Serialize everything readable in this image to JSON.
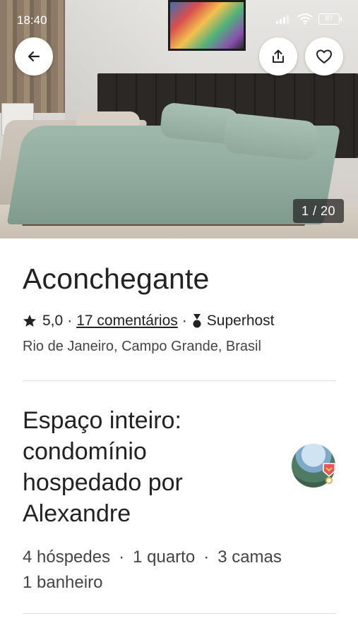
{
  "status_bar": {
    "time": "18:40",
    "battery": "87"
  },
  "gallery": {
    "counter": "1 / 20"
  },
  "listing": {
    "title": "Aconchegante",
    "rating": "5,0",
    "reviews": "17 comentários",
    "superhost_label": "Superhost",
    "location": "Rio de Janeiro, Campo Grande, Brasil"
  },
  "host_section": {
    "title_lines": [
      "Espaço inteiro:",
      "condomínio",
      "hospedado por",
      "Alexandre"
    ]
  },
  "specs": {
    "guests": "4 hóspedes",
    "bedrooms": "1 quarto",
    "beds": "3 camas",
    "bathrooms": "1 banheiro"
  },
  "icons": {
    "back": "arrow-left-icon",
    "share": "share-icon",
    "save": "heart-icon",
    "star": "star-icon",
    "superhost": "superhost-medal-icon"
  },
  "colors": {
    "text": "#222222",
    "secondary_text": "#444444",
    "divider": "#dddddd",
    "superhost_badge": "#e8555b"
  }
}
